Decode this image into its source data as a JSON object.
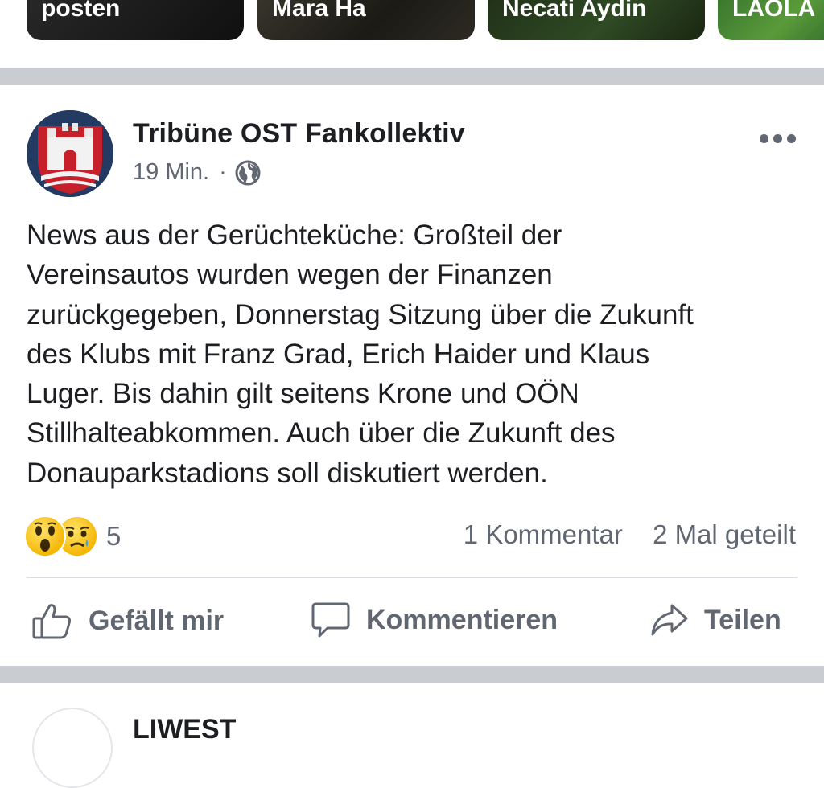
{
  "stories": [
    {
      "label": "posten"
    },
    {
      "label": "Mara Ha"
    },
    {
      "label": "Necati Aydin"
    },
    {
      "label": "LAOLA"
    }
  ],
  "post": {
    "page_name": "Tribüne OST Fankollektiv",
    "time": "19 Min.",
    "separator": "·",
    "privacy_icon": "globe-icon",
    "text": "News aus der Gerüchteküche: Großteil der\nVereinsautos wurden wegen der Finanzen\nzurückgegeben, Donnerstag Sitzung über die Zukunft\ndes Klubs mit Franz Grad, Erich Haider und Klaus\nLuger. Bis dahin gilt seitens Krone und OÖN\nStillhalteabkommen. Auch über die Zukunft des\nDonauparkstadions soll diskutiert werden.",
    "reaction_count": "5",
    "comments": "1 Kommentar",
    "shares": "2 Mal geteilt"
  },
  "actions": {
    "like": "Gefällt mir",
    "comment": "Kommentieren",
    "share": "Teilen"
  },
  "next_post": {
    "name": "LIWEST"
  },
  "colors": {
    "divider": "#c9ccd1",
    "secondary_text": "#606770",
    "primary_text": "#1c1e21"
  }
}
